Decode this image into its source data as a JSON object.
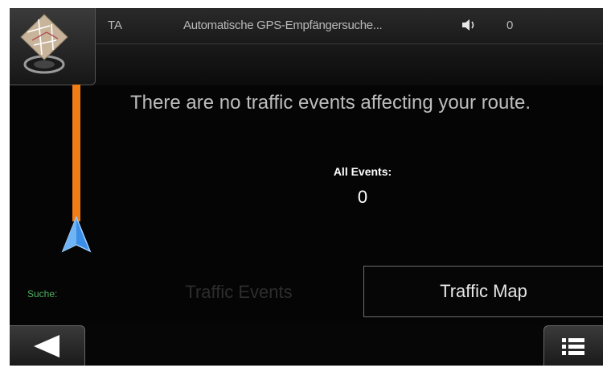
{
  "status_bar": {
    "ta": "TA",
    "gps_status": "Automatische GPS-Empfängersuche...",
    "speaker_icon": "speaker-icon",
    "count": "0"
  },
  "map_button": {
    "icon": "map-icon"
  },
  "route": {
    "color": "#f07d16",
    "arrow_color": "#3a8ee6"
  },
  "message": "There are no traffic events affecting your route.",
  "events": {
    "label": "All Events:",
    "count": "0"
  },
  "search": {
    "label": "Suche:",
    "color": "#4fb061"
  },
  "buttons": {
    "traffic_events": "Traffic Events",
    "traffic_map": "Traffic Map"
  },
  "bottom_bar": {
    "back_icon": "back-arrow-icon",
    "menu_icon": "menu-list-icon"
  }
}
